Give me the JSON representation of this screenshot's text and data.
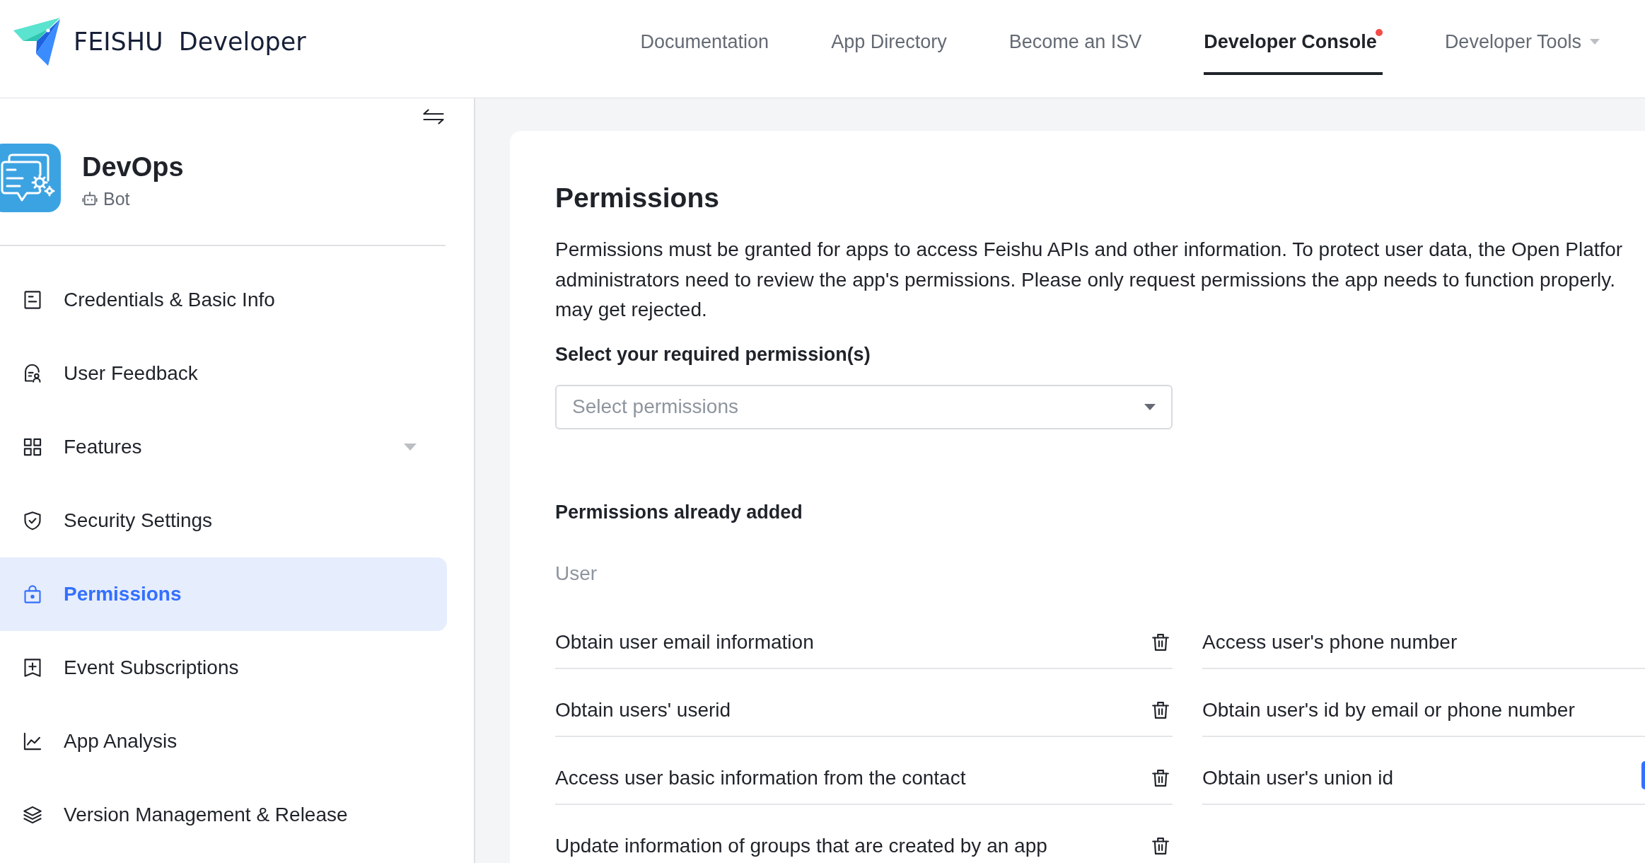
{
  "header": {
    "logo": {
      "brand": "FEISHU",
      "product": "Developer"
    },
    "nav": [
      {
        "label": "Documentation",
        "selected": false,
        "badge": false,
        "dropdown": false
      },
      {
        "label": "App Directory",
        "selected": false,
        "badge": false,
        "dropdown": false
      },
      {
        "label": "Become an ISV",
        "selected": false,
        "badge": false,
        "dropdown": false
      },
      {
        "label": "Developer Console",
        "selected": true,
        "badge": true,
        "dropdown": false
      },
      {
        "label": "Developer Tools",
        "selected": false,
        "badge": false,
        "dropdown": true
      }
    ]
  },
  "sidebar": {
    "app": {
      "name": "DevOps",
      "type": "Bot"
    },
    "items": [
      {
        "label": "Credentials & Basic Info",
        "selected": false,
        "expandable": false
      },
      {
        "label": "User Feedback",
        "selected": false,
        "expandable": false
      },
      {
        "label": "Features",
        "selected": false,
        "expandable": true
      },
      {
        "label": "Security Settings",
        "selected": false,
        "expandable": false
      },
      {
        "label": "Permissions",
        "selected": true,
        "expandable": false
      },
      {
        "label": "Event Subscriptions",
        "selected": false,
        "expandable": false
      },
      {
        "label": "App Analysis",
        "selected": false,
        "expandable": false
      },
      {
        "label": "Version Management & Release",
        "selected": false,
        "expandable": false
      }
    ]
  },
  "main": {
    "title": "Permissions",
    "description": [
      "Permissions must be granted for apps to access Feishu APIs and other information. To protect user data, the Open Platfor",
      "administrators need to review the app's permissions. Please only request permissions the app needs to function properly.",
      "may get rejected."
    ],
    "permission_select": {
      "label": "Select your required permission(s)",
      "placeholder": "Select permissions"
    },
    "added": {
      "heading": "Permissions already added",
      "groups": [
        {
          "name": "User",
          "items": [
            {
              "label": "Obtain user email information",
              "removable": true
            },
            {
              "label": "Access user's phone number",
              "removable": false
            },
            {
              "label": "Obtain users' userid",
              "removable": true
            },
            {
              "label": "Obtain user's id by email or phone number",
              "removable": false
            },
            {
              "label": "Access user basic information from the contact",
              "removable": true
            },
            {
              "label": "Obtain user's union id",
              "removable": false
            },
            {
              "label": "Update information of groups that are created by an app",
              "removable": true
            }
          ]
        }
      ]
    }
  }
}
